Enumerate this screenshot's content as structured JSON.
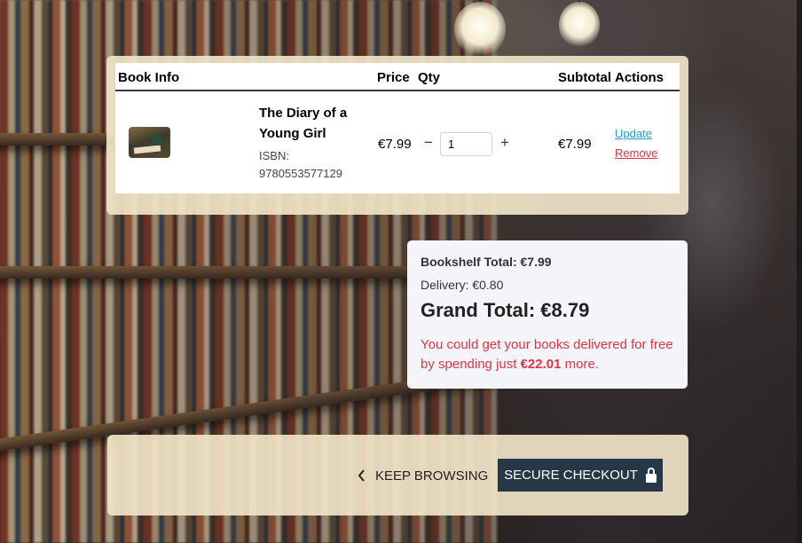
{
  "cart": {
    "headers": {
      "book_info": "Book Info",
      "price": "Price",
      "qty": "Qty",
      "subtotal": "Subtotal",
      "actions": "Actions"
    },
    "items": [
      {
        "title": "The Diary of a Young Girl",
        "isbn": "ISBN: 9780553577129",
        "price": "€7.99",
        "quantity": "1",
        "subtotal": "€7.99",
        "update_label": "Update",
        "remove_label": "Remove",
        "minus_symbol": "−",
        "plus_symbol": "+"
      }
    ]
  },
  "totals": {
    "bookshelf_total": "Bookshelf Total: €7.99",
    "delivery": "Delivery: €0.80",
    "grand_total": "Grand Total: €8.79",
    "free_delivery_prefix": "You could get your books delivered for free by spending just ",
    "free_delivery_amount": "€22.01",
    "free_delivery_suffix": " more."
  },
  "buttons": {
    "keep_browsing": "KEEP BROWSING",
    "keep_browsing_icon": "chevron-left-icon",
    "secure_checkout": "SECURE CHECKOUT",
    "secure_checkout_icon": "lock-icon"
  },
  "colors": {
    "panel": "#f0e4c8",
    "checkout_button": "#263848",
    "update_link": "#17a2d8",
    "remove_link": "#dc3545",
    "free_delivery_text": "#dc3545"
  }
}
